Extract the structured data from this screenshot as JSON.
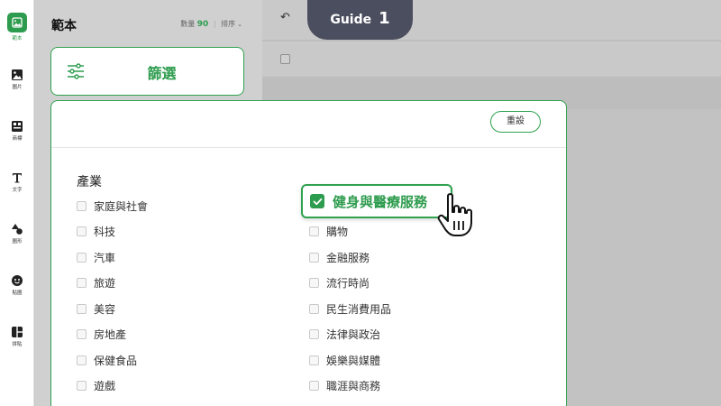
{
  "rail": {
    "items": [
      {
        "label": "範本",
        "icon": "template-icon",
        "active": true
      },
      {
        "label": "圖片",
        "icon": "image-icon"
      },
      {
        "label": "商標",
        "icon": "logo-icon"
      },
      {
        "label": "文字",
        "icon": "text-icon"
      },
      {
        "label": "圖形",
        "icon": "shapes-icon"
      },
      {
        "label": "貼圖",
        "icon": "sticker-icon"
      },
      {
        "label": "拼貼",
        "icon": "collage-icon"
      }
    ]
  },
  "panel": {
    "title": "範本",
    "count_label": "數量",
    "count": "90",
    "sort_label": "排序"
  },
  "guide": {
    "label": "Guide",
    "step": "1"
  },
  "filter_button": {
    "label": "篩選",
    "icon": "filter-sliders-icon"
  },
  "filter_modal": {
    "reset_label": "重設",
    "section_title": "產業",
    "left_options": [
      "家庭與社會",
      "科技",
      "汽車",
      "旅遊",
      "美容",
      "房地產",
      "保健食品",
      "遊戲"
    ],
    "right_selected": "健身與醫療服務",
    "right_options": [
      "購物",
      "金融服務",
      "流行時尚",
      "民生消費用品",
      "法律與政治",
      "娛樂與媒體",
      "職涯與商務"
    ]
  },
  "colors": {
    "accent": "#2e9c4e",
    "guide_tab": "#4b4e5e"
  }
}
